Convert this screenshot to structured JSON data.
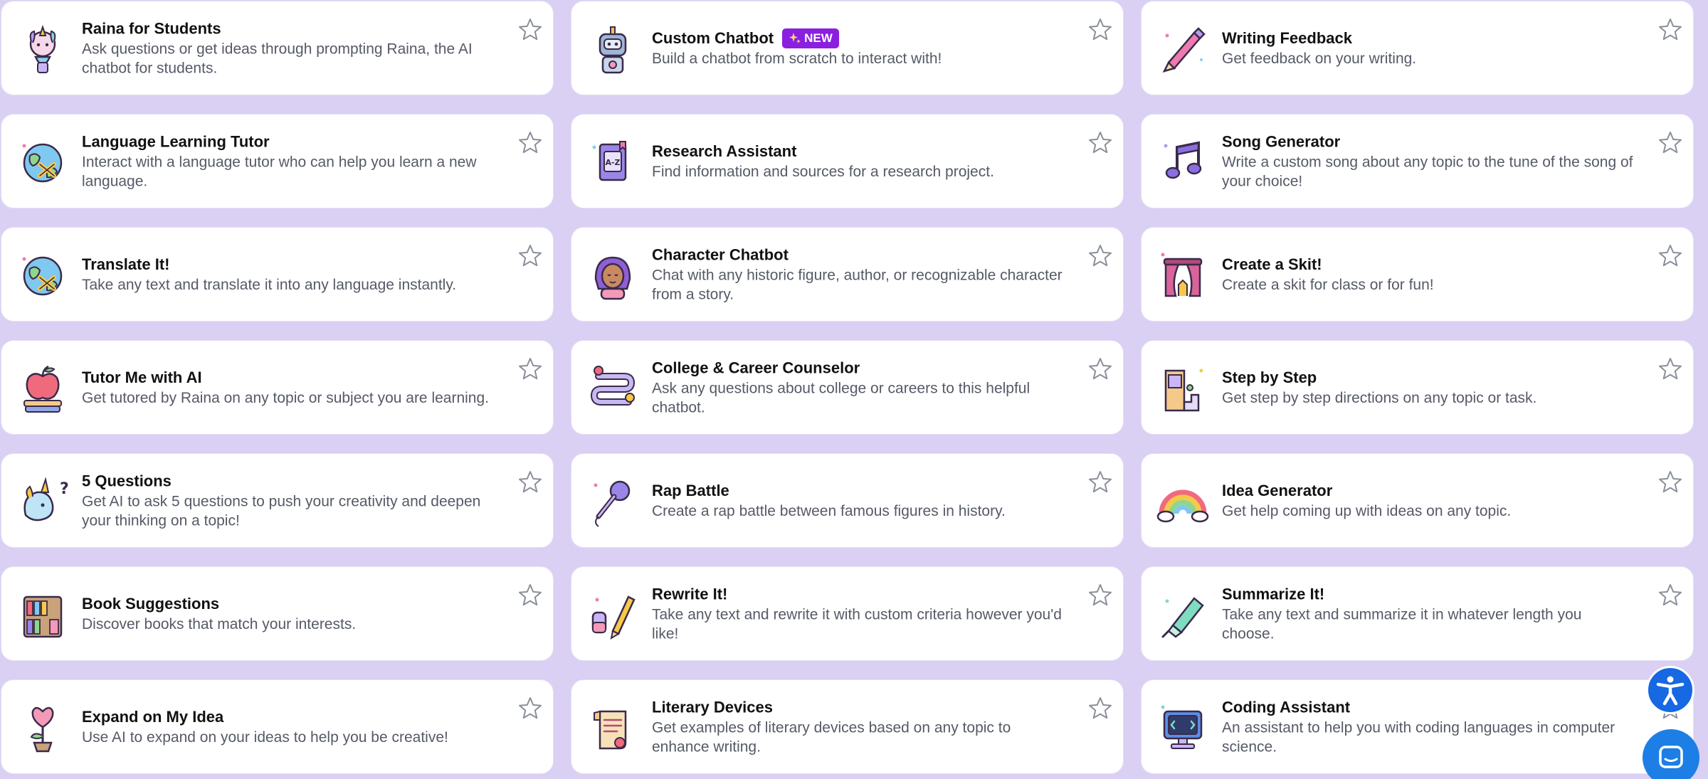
{
  "badge_new": "NEW",
  "cards": [
    {
      "title": "Raina for Students",
      "desc": "Ask questions or get ideas through prompting Raina, the AI chatbot for students.",
      "icon": "unicorn-icon"
    },
    {
      "title": "Custom Chatbot",
      "desc": "Build a chatbot from scratch to interact with!",
      "icon": "robot-icon",
      "badge": true
    },
    {
      "title": "Writing Feedback",
      "desc": "Get feedback on your writing.",
      "icon": "pen-icon"
    },
    {
      "title": "Language Learning Tutor",
      "desc": "Interact with a language tutor who can help you learn a new language.",
      "icon": "globe-icon"
    },
    {
      "title": "Research Assistant",
      "desc": "Find information and sources for a research project.",
      "icon": "book-a-z-icon"
    },
    {
      "title": "Song Generator",
      "desc": "Write a custom song about any topic to the tune of the song of your choice!",
      "icon": "music-note-icon"
    },
    {
      "title": "Translate It!",
      "desc": "Take any text and translate it into any language instantly.",
      "icon": "globe-icon"
    },
    {
      "title": "Character Chatbot",
      "desc": "Chat with any historic figure, author, or recognizable character from a story.",
      "icon": "character-icon"
    },
    {
      "title": "Create a Skit!",
      "desc": "Create a skit for class or for fun!",
      "icon": "theater-stage-icon"
    },
    {
      "title": "Tutor Me with AI",
      "desc": "Get tutored by Raina on any topic or subject you are learning.",
      "icon": "apple-books-icon"
    },
    {
      "title": "College & Career Counselor",
      "desc": "Ask any questions about college or careers to this helpful chatbot.",
      "icon": "road-map-icon"
    },
    {
      "title": "Step by Step",
      "desc": "Get step by step directions on any topic or task.",
      "icon": "stairs-icon"
    },
    {
      "title": "5 Questions",
      "desc": "Get AI to ask 5 questions to push your creativity and deepen your thinking on a topic!",
      "icon": "unicorn-question-icon"
    },
    {
      "title": "Rap Battle",
      "desc": "Create a rap battle between famous figures in history.",
      "icon": "microphone-icon"
    },
    {
      "title": "Idea Generator",
      "desc": "Get help coming up with ideas on any topic.",
      "icon": "rainbow-icon"
    },
    {
      "title": "Book Suggestions",
      "desc": "Discover books that match your interests.",
      "icon": "bookshelf-icon"
    },
    {
      "title": "Rewrite It!",
      "desc": "Take any text and rewrite it with custom criteria however you'd like!",
      "icon": "pencil-eraser-icon"
    },
    {
      "title": "Summarize It!",
      "desc": "Take any text and summarize it in whatever length you choose.",
      "icon": "highlighter-icon"
    },
    {
      "title": "Expand on My Idea",
      "desc": "Use AI to expand on your ideas to help you be creative!",
      "icon": "heart-plant-icon"
    },
    {
      "title": "Literary Devices",
      "desc": "Get examples of literary devices based on any topic to enhance writing.",
      "icon": "scroll-icon"
    },
    {
      "title": "Coding Assistant",
      "desc": "An assistant to help you with coding languages in computer science.",
      "icon": "computer-icon"
    }
  ],
  "colors": {
    "background": "#d9d0f3",
    "badge": "#8b1fe0",
    "floating_button": "#1668e3"
  },
  "floating": {
    "accessibility_icon": "accessibility-icon",
    "chat_icon": "chat-bubble-icon"
  }
}
